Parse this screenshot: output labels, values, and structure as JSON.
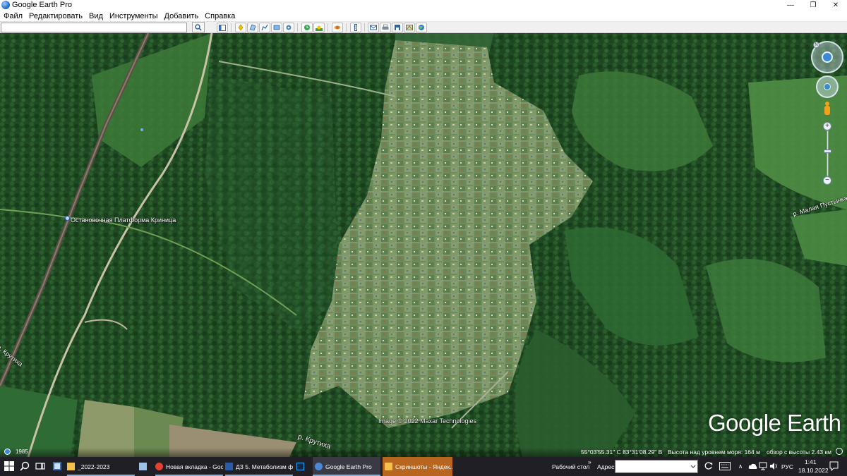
{
  "window": {
    "title": "Google Earth Pro",
    "min_icon": "—",
    "max_icon": "❐",
    "close_icon": "✕"
  },
  "menu": [
    "Файл",
    "Редактировать",
    "Вид",
    "Инструменты",
    "Добавить",
    "Справка"
  ],
  "search": {
    "value": "",
    "placeholder": ""
  },
  "map": {
    "place_label": "Остановочная Платформа Криница",
    "river_labels": [
      "р. Крутиха",
      "р. Крутиха",
      "р. Малая Пустынка"
    ],
    "copyright": "Image © 2022 Maxar Technologies",
    "logo": "Google Earth",
    "status": {
      "year": "1985",
      "coords": "55°03'55.31\" С   83°31'08.29\" В",
      "elevation": "Высота над уровнем моря:   164 м",
      "eye_alt": "обзор с высоты   2.43 км"
    },
    "nav": {
      "north": "N",
      "zoom_in": "+",
      "zoom_out": "−"
    }
  },
  "taskbar": {
    "tasks": [
      {
        "label": "_2022-2023",
        "icon": "folder-icon",
        "color": "#f3c14b"
      },
      {
        "label": "",
        "icon": "document-icon",
        "color": "#9fc2ea"
      },
      {
        "label": "Новая вкладка - Goo...",
        "icon": "chrome-icon",
        "color": "#e44133"
      },
      {
        "label": "ДЗ 5. Метаболизм ф...",
        "icon": "word-icon",
        "color": "#2b5aa8"
      },
      {
        "label": "",
        "icon": "photoshop-icon",
        "color": "#2fa3f6"
      },
      {
        "label": "Google Earth Pro",
        "icon": "google-earth-icon",
        "color": "#4a8ad4"
      },
      {
        "label": "Скриншоты - Яндек...",
        "icon": "folder-icon",
        "color": "#f3c14b"
      }
    ],
    "desktop_label": "Рабочий стол",
    "chevron": "»",
    "address_label": "Адрес",
    "language": "РУС",
    "time": "1:41",
    "date": "18.10.2022",
    "arrow_up": "∧"
  }
}
